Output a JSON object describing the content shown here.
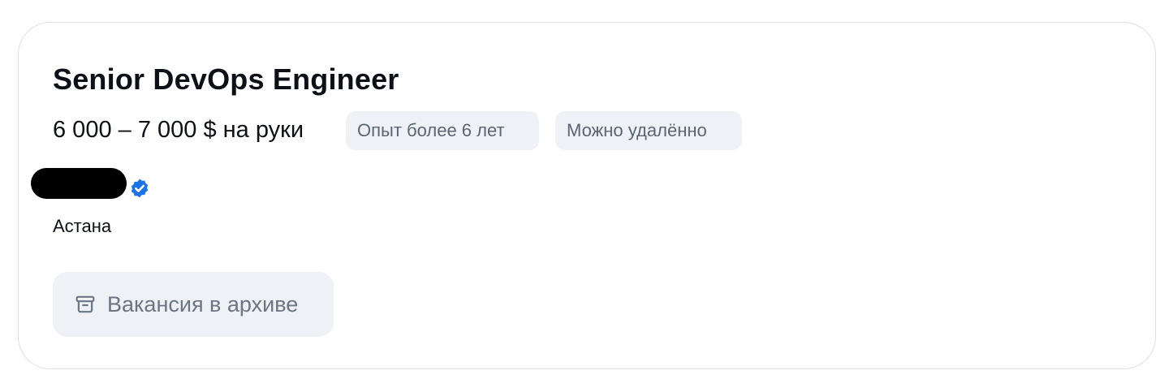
{
  "vacancy": {
    "title": "Senior DevOps Engineer",
    "salary": "6 000 – 7 000 $ на руки",
    "tags": [
      {
        "label": "Опыт более 6 лет"
      },
      {
        "label": "Можно удалённо"
      }
    ],
    "company": {
      "name": "",
      "verified_icon": "verified-badge-icon",
      "verified_color": "#1a73e8"
    },
    "city": "Астана",
    "archive_button": {
      "label": "Вакансия в архиве",
      "icon": "archive-box-icon"
    }
  },
  "colors": {
    "text_primary": "#0d1117",
    "text_muted": "#6b7583",
    "tag_background": "#eef1f5",
    "card_border": "#dcdfe4"
  }
}
